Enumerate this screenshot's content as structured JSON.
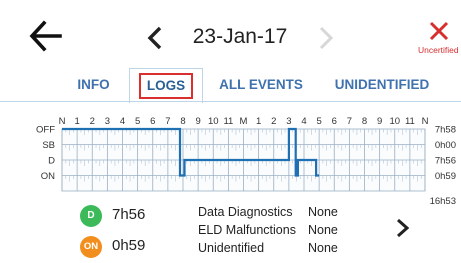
{
  "header": {
    "back_icon": "arrow-left-icon",
    "prev_icon": "chevron-left-icon",
    "next_icon": "chevron-right-icon",
    "date": "23-Jan-17",
    "uncertify": {
      "icon": "close-x-icon",
      "label": "Uncertified",
      "color": "#d62f2f"
    }
  },
  "tabs": [
    {
      "label": "INFO",
      "active": false
    },
    {
      "label": "LOGS",
      "active": true
    },
    {
      "label": "ALL EVENTS",
      "active": false
    },
    {
      "label": "UNIDENTIFIED",
      "active": false
    }
  ],
  "log_grid": {
    "hour_labels": [
      "N",
      "1",
      "2",
      "3",
      "4",
      "5",
      "6",
      "7",
      "8",
      "9",
      "10",
      "11",
      "M",
      "1",
      "2",
      "3",
      "4",
      "5",
      "6",
      "7",
      "8",
      "9",
      "10",
      "11",
      "N"
    ],
    "status_labels": [
      "OFF",
      "SB",
      "D",
      "ON"
    ],
    "totals": [
      "7h58",
      "0h00",
      "7h56",
      "0h59"
    ],
    "grand_total": "16h53",
    "line_color": "#1f6fb3",
    "segments": [
      {
        "status": "OFF",
        "start": 0,
        "end": 7.8
      },
      {
        "status": "ON",
        "start": 7.8,
        "end": 8.1
      },
      {
        "status": "D",
        "start": 8.1,
        "end": 15.0
      },
      {
        "status": "OFF",
        "start": 15.0,
        "end": 15.45
      },
      {
        "status": "ON",
        "start": 15.45,
        "end": 15.6
      },
      {
        "status": "D",
        "start": 15.6,
        "end": 16.8
      },
      {
        "status": "ON",
        "start": 16.8,
        "end": 17.0
      }
    ]
  },
  "summary": {
    "driving": {
      "badge": "D",
      "duration": "7h56",
      "color": "#3cba5a"
    },
    "on_duty": {
      "badge": "ON",
      "duration": "0h59",
      "color": "#f28e1e"
    },
    "rows": [
      {
        "label": "Data Diagnostics",
        "value": "None"
      },
      {
        "label": "ELD Malfunctions",
        "value": "None"
      },
      {
        "label": "Unidentified",
        "value": "None"
      }
    ],
    "more_icon": "chevron-right-icon"
  }
}
